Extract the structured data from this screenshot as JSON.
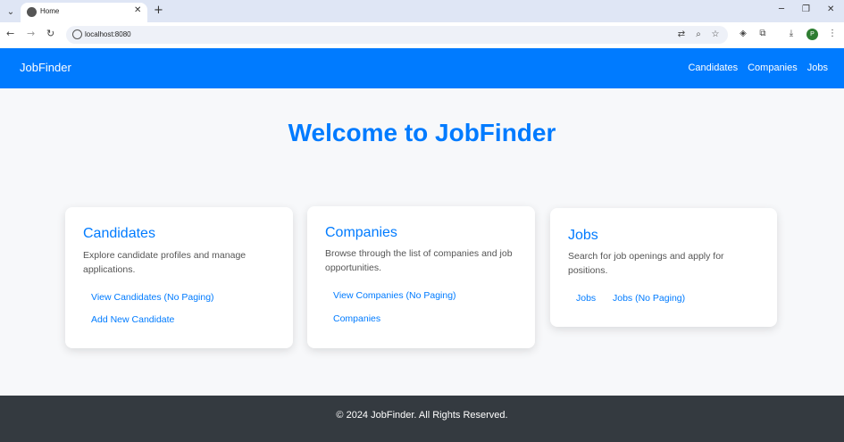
{
  "browser": {
    "tab_title": "Home",
    "url": "localhost:8080",
    "profile_initial": "P"
  },
  "nav": {
    "brand": "JobFinder",
    "links": [
      "Candidates",
      "Companies",
      "Jobs"
    ]
  },
  "hero": {
    "title": "Welcome to JobFinder"
  },
  "cards": [
    {
      "title": "Candidates",
      "description": "Explore candidate profiles and manage applications.",
      "links": [
        "View Candidates (No Paging)",
        "Add New Candidate"
      ]
    },
    {
      "title": "Companies",
      "description": "Browse through the list of companies and job opportunities.",
      "links": [
        "View Companies (No Paging)",
        "Companies"
      ]
    },
    {
      "title": "Jobs",
      "description": "Search for job openings and apply for positions.",
      "links": [
        "Jobs",
        "Jobs (No Paging)"
      ]
    }
  ],
  "footer": {
    "text": "© 2024 JobFinder. All Rights Reserved."
  },
  "colors": {
    "primary": "#007bff",
    "footer_bg": "#343a40",
    "page_bg": "#f7f8fa"
  }
}
